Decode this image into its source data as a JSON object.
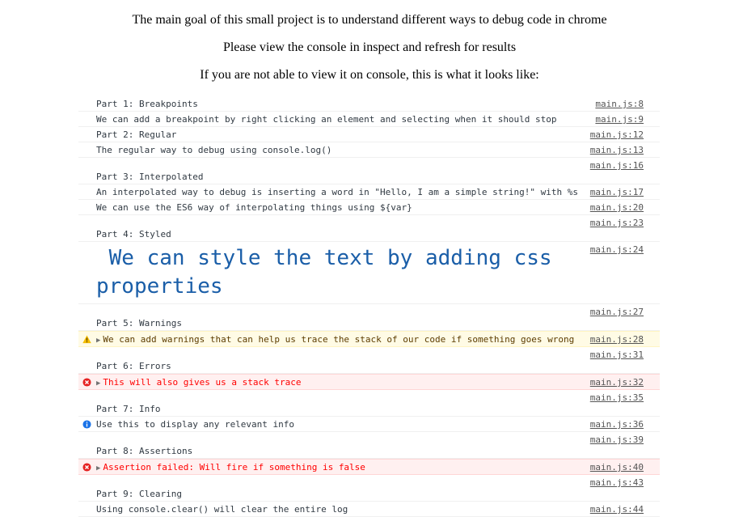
{
  "intro": {
    "line1": "The main goal of this small project is to understand different ways to debug code in chrome",
    "line2": "Please view the console in inspect and refresh for results",
    "line3": "If you are not able to view it on console, this is what it looks like:"
  },
  "console": {
    "part1_title": "Part 1: Breakpoints",
    "part1_title_src": "main.js:8",
    "part1_text": "We can add a breakpoint by right clicking an element and selecting when it should stop",
    "part1_text_src": "main.js:9",
    "part2_title": "Part 2: Regular",
    "part2_title_src": "main.js:12",
    "part2_text": "The regular way to debug using console.log()",
    "part2_text_src": "main.js:13",
    "blank1_src": "main.js:16",
    "part3_title": "Part 3: Interpolated",
    "part3_text": "An interpolated way to debug is inserting a word in \"Hello, I am a simple string!\" with %s",
    "part3_text_src": "main.js:17",
    "part3_text2": "We can use the ES6 way of interpolating things using ${var}",
    "part3_text2_src": "main.js:20",
    "blank2_src": "main.js:23",
    "part4_title": "Part 4: Styled",
    "part4_styled": " We can style the text by adding css properties",
    "part4_styled_src": "main.js:24",
    "blank3_src": "main.js:27",
    "part5_title": "Part 5: Warnings",
    "part5_warn": "We can add warnings that can help us trace the stack of our code if something goes wrong",
    "part5_warn_src": "main.js:28",
    "blank4_src": "main.js:31",
    "part6_title": "Part 6: Errors",
    "part6_err": "This will also gives us a stack trace",
    "part6_err_src": "main.js:32",
    "blank5_src": "main.js:35",
    "part7_title": "Part 7: Info",
    "part7_info": "Use this to display any relevant info",
    "part7_info_src": "main.js:36",
    "blank6_src": "main.js:39",
    "part8_title": "Part 8: Assertions",
    "part8_err": "Assertion failed: Will fire if something is false",
    "part8_err_src": "main.js:40",
    "blank7_src": "main.js:43",
    "part9_title": "Part 9: Clearing",
    "part9_text": "Using console.clear() will clear the entire log",
    "part9_text_src": "main.js:44"
  },
  "icons": {
    "warning": "warning-icon",
    "error": "error-icon",
    "info": "info-icon",
    "expand": "expand-triangle-icon"
  },
  "colors": {
    "warning_bg": "#fffbe5",
    "error_bg": "#fff0f0",
    "error_text": "#ff0000",
    "styled_text": "#1a5ea8",
    "info_icon": "#1a73e8"
  }
}
